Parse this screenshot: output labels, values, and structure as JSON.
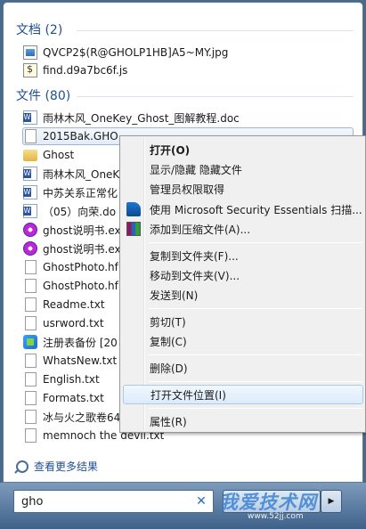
{
  "groups": {
    "documents": {
      "title": "文档 (2)",
      "items": [
        "QVCP2$(R@GHOLP1HB]A5~MY.jpg",
        "find.d9a7bc6f.js"
      ]
    },
    "files": {
      "title": "文件 (80)",
      "items": [
        "雨林木风_OneKey_Ghost_图解教程.doc",
        "2015Bak.GHO",
        "Ghost",
        "雨林木风_OneK",
        "中苏关系正常化",
        "（05）向荣.do",
        "ghost说明书.ex",
        "ghost说明书.ex",
        "GhostPhoto.hf",
        "GhostPhoto.hf",
        "Readme.txt",
        "usrword.txt",
        "注册表备份 [20",
        "WhatsNew.txt",
        "English.txt",
        "Formats.txt",
        "冰与火之歌卷64",
        "memnoch the devil.txt"
      ]
    }
  },
  "more_results": "查看更多结果",
  "search": {
    "value": "gho",
    "clear": "✕"
  },
  "watermark": {
    "big": "我爱技术网",
    "small": "www.52jj.com"
  },
  "context_menu": {
    "items": [
      "打开(O)",
      "显示/隐藏 隐藏文件",
      "管理员权限取得",
      "使用 Microsoft Security Essentials 扫描...",
      "添加到压缩文件(A)...",
      "复制到文件夹(F)...",
      "移动到文件夹(V)...",
      "发送到(N)",
      "剪切(T)",
      "复制(C)",
      "删除(D)",
      "打开文件位置(I)",
      "属性(R)"
    ]
  }
}
